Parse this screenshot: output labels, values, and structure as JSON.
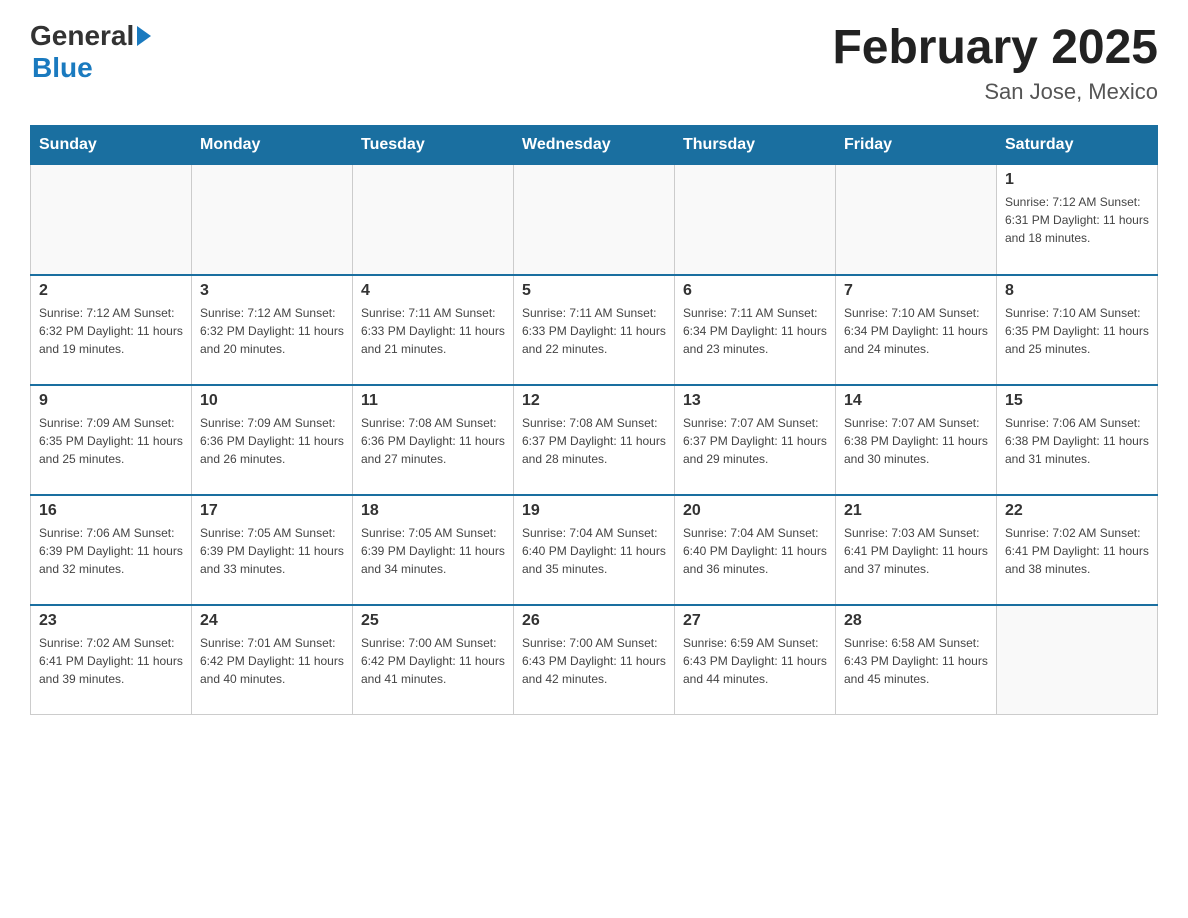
{
  "header": {
    "logo": {
      "general": "General",
      "blue": "Blue",
      "arrow": "▶"
    },
    "title": "February 2025",
    "subtitle": "San Jose, Mexico"
  },
  "weekdays": [
    "Sunday",
    "Monday",
    "Tuesday",
    "Wednesday",
    "Thursday",
    "Friday",
    "Saturday"
  ],
  "weeks": [
    [
      {
        "day": "",
        "info": ""
      },
      {
        "day": "",
        "info": ""
      },
      {
        "day": "",
        "info": ""
      },
      {
        "day": "",
        "info": ""
      },
      {
        "day": "",
        "info": ""
      },
      {
        "day": "",
        "info": ""
      },
      {
        "day": "1",
        "info": "Sunrise: 7:12 AM\nSunset: 6:31 PM\nDaylight: 11 hours and 18 minutes."
      }
    ],
    [
      {
        "day": "2",
        "info": "Sunrise: 7:12 AM\nSunset: 6:32 PM\nDaylight: 11 hours and 19 minutes."
      },
      {
        "day": "3",
        "info": "Sunrise: 7:12 AM\nSunset: 6:32 PM\nDaylight: 11 hours and 20 minutes."
      },
      {
        "day": "4",
        "info": "Sunrise: 7:11 AM\nSunset: 6:33 PM\nDaylight: 11 hours and 21 minutes."
      },
      {
        "day": "5",
        "info": "Sunrise: 7:11 AM\nSunset: 6:33 PM\nDaylight: 11 hours and 22 minutes."
      },
      {
        "day": "6",
        "info": "Sunrise: 7:11 AM\nSunset: 6:34 PM\nDaylight: 11 hours and 23 minutes."
      },
      {
        "day": "7",
        "info": "Sunrise: 7:10 AM\nSunset: 6:34 PM\nDaylight: 11 hours and 24 minutes."
      },
      {
        "day": "8",
        "info": "Sunrise: 7:10 AM\nSunset: 6:35 PM\nDaylight: 11 hours and 25 minutes."
      }
    ],
    [
      {
        "day": "9",
        "info": "Sunrise: 7:09 AM\nSunset: 6:35 PM\nDaylight: 11 hours and 25 minutes."
      },
      {
        "day": "10",
        "info": "Sunrise: 7:09 AM\nSunset: 6:36 PM\nDaylight: 11 hours and 26 minutes."
      },
      {
        "day": "11",
        "info": "Sunrise: 7:08 AM\nSunset: 6:36 PM\nDaylight: 11 hours and 27 minutes."
      },
      {
        "day": "12",
        "info": "Sunrise: 7:08 AM\nSunset: 6:37 PM\nDaylight: 11 hours and 28 minutes."
      },
      {
        "day": "13",
        "info": "Sunrise: 7:07 AM\nSunset: 6:37 PM\nDaylight: 11 hours and 29 minutes."
      },
      {
        "day": "14",
        "info": "Sunrise: 7:07 AM\nSunset: 6:38 PM\nDaylight: 11 hours and 30 minutes."
      },
      {
        "day": "15",
        "info": "Sunrise: 7:06 AM\nSunset: 6:38 PM\nDaylight: 11 hours and 31 minutes."
      }
    ],
    [
      {
        "day": "16",
        "info": "Sunrise: 7:06 AM\nSunset: 6:39 PM\nDaylight: 11 hours and 32 minutes."
      },
      {
        "day": "17",
        "info": "Sunrise: 7:05 AM\nSunset: 6:39 PM\nDaylight: 11 hours and 33 minutes."
      },
      {
        "day": "18",
        "info": "Sunrise: 7:05 AM\nSunset: 6:39 PM\nDaylight: 11 hours and 34 minutes."
      },
      {
        "day": "19",
        "info": "Sunrise: 7:04 AM\nSunset: 6:40 PM\nDaylight: 11 hours and 35 minutes."
      },
      {
        "day": "20",
        "info": "Sunrise: 7:04 AM\nSunset: 6:40 PM\nDaylight: 11 hours and 36 minutes."
      },
      {
        "day": "21",
        "info": "Sunrise: 7:03 AM\nSunset: 6:41 PM\nDaylight: 11 hours and 37 minutes."
      },
      {
        "day": "22",
        "info": "Sunrise: 7:02 AM\nSunset: 6:41 PM\nDaylight: 11 hours and 38 minutes."
      }
    ],
    [
      {
        "day": "23",
        "info": "Sunrise: 7:02 AM\nSunset: 6:41 PM\nDaylight: 11 hours and 39 minutes."
      },
      {
        "day": "24",
        "info": "Sunrise: 7:01 AM\nSunset: 6:42 PM\nDaylight: 11 hours and 40 minutes."
      },
      {
        "day": "25",
        "info": "Sunrise: 7:00 AM\nSunset: 6:42 PM\nDaylight: 11 hours and 41 minutes."
      },
      {
        "day": "26",
        "info": "Sunrise: 7:00 AM\nSunset: 6:43 PM\nDaylight: 11 hours and 42 minutes."
      },
      {
        "day": "27",
        "info": "Sunrise: 6:59 AM\nSunset: 6:43 PM\nDaylight: 11 hours and 44 minutes."
      },
      {
        "day": "28",
        "info": "Sunrise: 6:58 AM\nSunset: 6:43 PM\nDaylight: 11 hours and 45 minutes."
      },
      {
        "day": "",
        "info": ""
      }
    ]
  ]
}
